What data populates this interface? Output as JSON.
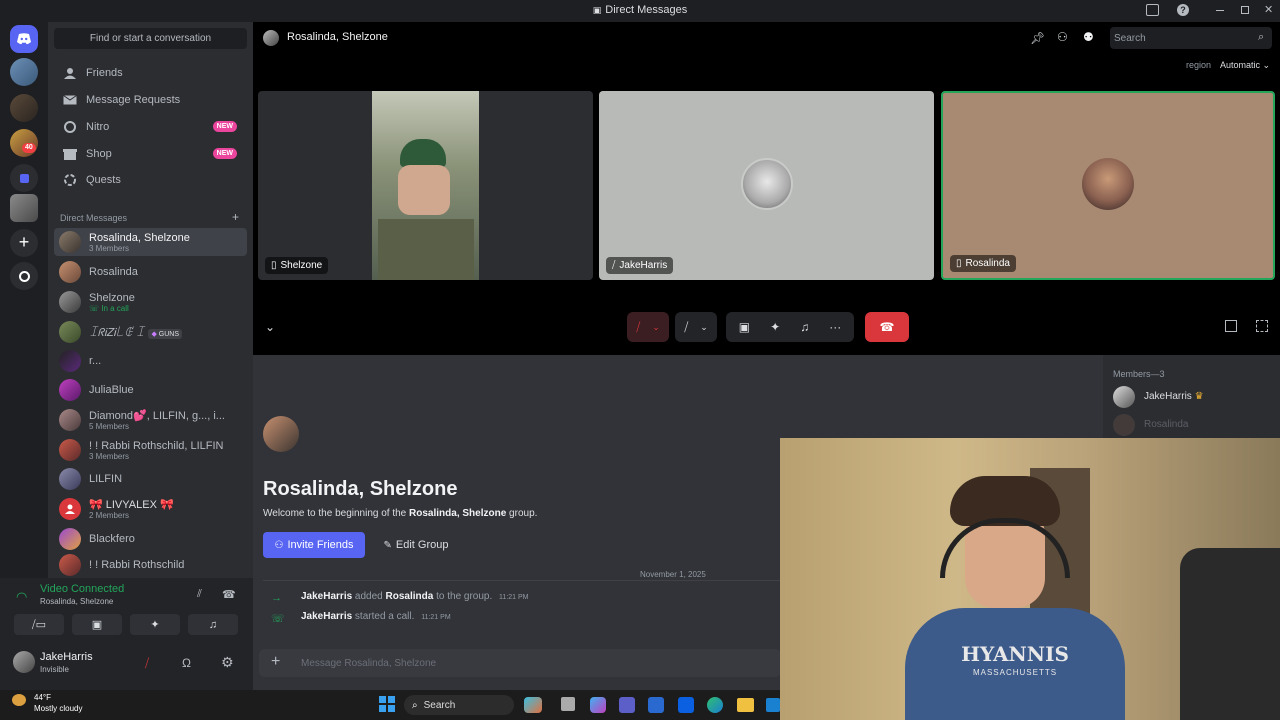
{
  "window": {
    "title": "Direct Messages"
  },
  "rail": {
    "mention_count": "40"
  },
  "sidebar": {
    "find_placeholder": "Find or start a conversation",
    "nav": [
      {
        "label": "Friends",
        "icon": "friends-icon"
      },
      {
        "label": "Message Requests",
        "icon": "envelope-icon"
      },
      {
        "label": "Nitro",
        "icon": "nitro-icon",
        "badge": "NEW"
      },
      {
        "label": "Shop",
        "icon": "shop-icon",
        "badge": "NEW"
      },
      {
        "label": "Quests",
        "icon": "quests-icon"
      }
    ],
    "dm_header": "Direct Messages",
    "dms": [
      {
        "name": "Rosalinda, Shelzone",
        "sub": "3 Members"
      },
      {
        "name": "Rosalinda",
        "sub": ""
      },
      {
        "name": "Shelzone",
        "sub": "In a call"
      },
      {
        "name": "ꀤᖇᎥᏃᎥ꒒ꂅ ꀤ",
        "sub": "",
        "tag": "GUNS"
      },
      {
        "name": "r...",
        "sub": ""
      },
      {
        "name": "JuliaBlue",
        "sub": ""
      },
      {
        "name": "Diamond💕, LILFIN, g..., i...",
        "sub": "5 Members"
      },
      {
        "name": "! ! Rabbi Rothschild, LILFIN",
        "sub": "3 Members"
      },
      {
        "name": "LILFIN",
        "sub": ""
      },
      {
        "name": "🎀 LIVYALEX 🎀",
        "sub": "2 Members"
      },
      {
        "name": "Blackfero",
        "sub": ""
      },
      {
        "name": "! ! Rabbi Rothschild",
        "sub": ""
      }
    ]
  },
  "voice": {
    "status": "Video Connected",
    "channel": "Rosalinda, Shelzone"
  },
  "user": {
    "name": "JakeHarris",
    "status": "Invisible"
  },
  "weather": {
    "temp": "44°F",
    "condition": "Mostly cloudy"
  },
  "header": {
    "title": "Rosalinda, Shelzone",
    "search_placeholder": "Search",
    "region_label": "region",
    "region_value": "Automatic"
  },
  "tiles": [
    {
      "name": "Shelzone"
    },
    {
      "name": "JakeHarris"
    },
    {
      "name": "Rosalinda"
    }
  ],
  "chat": {
    "group_title": "Rosalinda, Shelzone",
    "welcome_prefix": "Welcome to the beginning of the ",
    "welcome_group": "Rosalinda, Shelzone",
    "welcome_suffix": " group.",
    "invite_label": "Invite Friends",
    "edit_label": "Edit Group",
    "date_divider": "November 1, 2025",
    "events": [
      {
        "actor": "JakeHarris",
        "text1": " added ",
        "target": "Rosalinda",
        "text2": " to the group.",
        "time": "11:21 PM"
      },
      {
        "actor": "JakeHarris",
        "text1": " started a call.",
        "target": "",
        "text2": "",
        "time": "11:21 PM"
      }
    ],
    "message_placeholder": "Message Rosalinda, Shelzone"
  },
  "members": {
    "header": "Members—3",
    "list": [
      "JakeHarris",
      "Rosalinda"
    ]
  },
  "taskbar": {
    "search_label": "Search"
  },
  "webcam": {
    "shirt_text": "HYANNIS",
    "shirt_sub": "MASSACHUSETTS"
  }
}
